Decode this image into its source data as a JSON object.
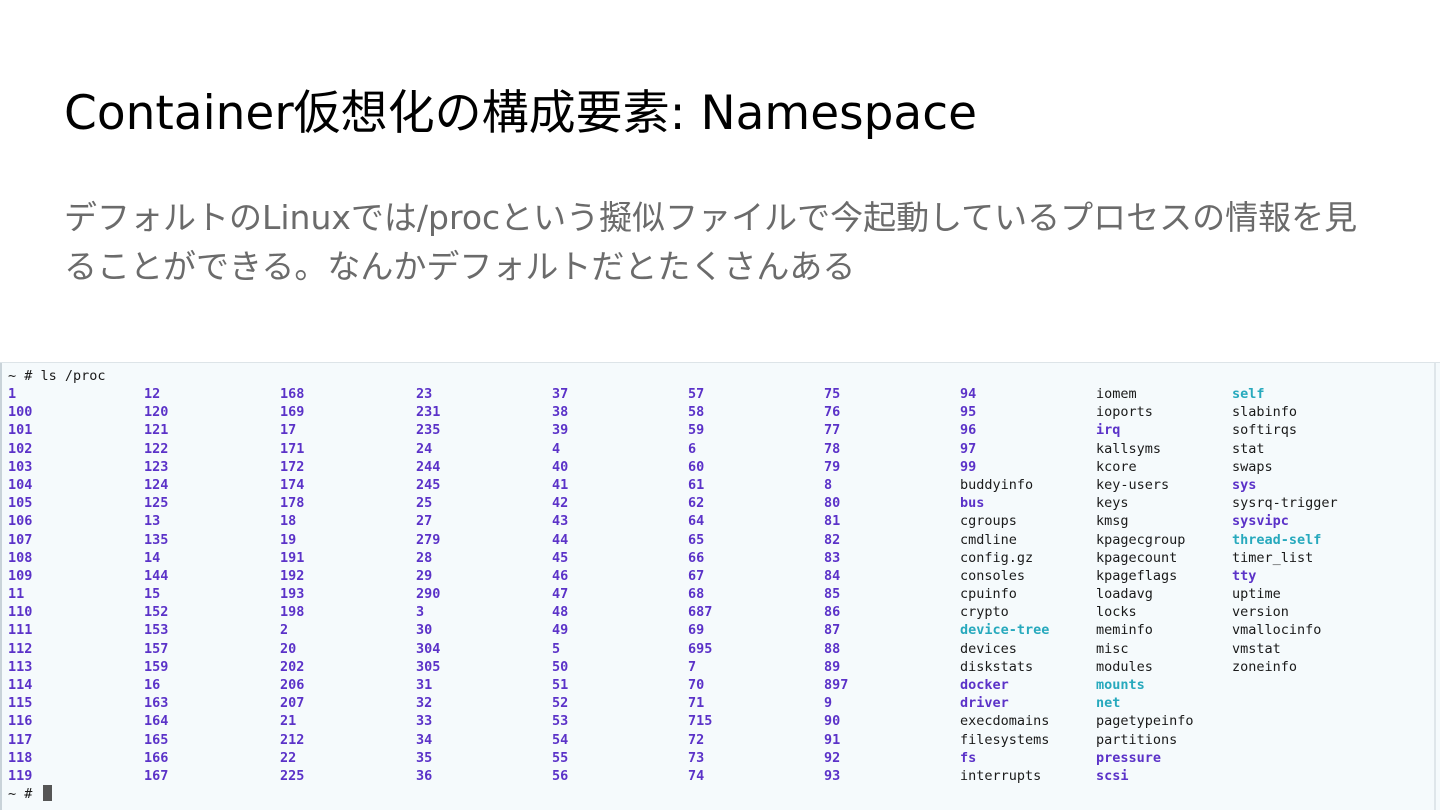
{
  "slide": {
    "title": "Container仮想化の構成要素: Namespace",
    "body": "デフォルトのLinuxでは/procという擬似ファイルで今起動しているプロセスの情報を見ることができる。なんかデフォルトだとたくさんある"
  },
  "terminal": {
    "command_prompt": "~ # ls /proc",
    "end_prompt": "~ # ",
    "colors": {
      "background": "#f5fafc",
      "directory": "#5b32c8",
      "symlink": "#27a9bd",
      "file": "#1a1a1a"
    },
    "columns": [
      [
        {
          "name": "1",
          "kind": "dir"
        },
        {
          "name": "100",
          "kind": "dir"
        },
        {
          "name": "101",
          "kind": "dir"
        },
        {
          "name": "102",
          "kind": "dir"
        },
        {
          "name": "103",
          "kind": "dir"
        },
        {
          "name": "104",
          "kind": "dir"
        },
        {
          "name": "105",
          "kind": "dir"
        },
        {
          "name": "106",
          "kind": "dir"
        },
        {
          "name": "107",
          "kind": "dir"
        },
        {
          "name": "108",
          "kind": "dir"
        },
        {
          "name": "109",
          "kind": "dir"
        },
        {
          "name": "11",
          "kind": "dir"
        },
        {
          "name": "110",
          "kind": "dir"
        },
        {
          "name": "111",
          "kind": "dir"
        },
        {
          "name": "112",
          "kind": "dir"
        },
        {
          "name": "113",
          "kind": "dir"
        },
        {
          "name": "114",
          "kind": "dir"
        },
        {
          "name": "115",
          "kind": "dir"
        },
        {
          "name": "116",
          "kind": "dir"
        },
        {
          "name": "117",
          "kind": "dir"
        },
        {
          "name": "118",
          "kind": "dir"
        },
        {
          "name": "119",
          "kind": "dir"
        }
      ],
      [
        {
          "name": "12",
          "kind": "dir"
        },
        {
          "name": "120",
          "kind": "dir"
        },
        {
          "name": "121",
          "kind": "dir"
        },
        {
          "name": "122",
          "kind": "dir"
        },
        {
          "name": "123",
          "kind": "dir"
        },
        {
          "name": "124",
          "kind": "dir"
        },
        {
          "name": "125",
          "kind": "dir"
        },
        {
          "name": "13",
          "kind": "dir"
        },
        {
          "name": "135",
          "kind": "dir"
        },
        {
          "name": "14",
          "kind": "dir"
        },
        {
          "name": "144",
          "kind": "dir"
        },
        {
          "name": "15",
          "kind": "dir"
        },
        {
          "name": "152",
          "kind": "dir"
        },
        {
          "name": "153",
          "kind": "dir"
        },
        {
          "name": "157",
          "kind": "dir"
        },
        {
          "name": "159",
          "kind": "dir"
        },
        {
          "name": "16",
          "kind": "dir"
        },
        {
          "name": "163",
          "kind": "dir"
        },
        {
          "name": "164",
          "kind": "dir"
        },
        {
          "name": "165",
          "kind": "dir"
        },
        {
          "name": "166",
          "kind": "dir"
        },
        {
          "name": "167",
          "kind": "dir"
        }
      ],
      [
        {
          "name": "168",
          "kind": "dir"
        },
        {
          "name": "169",
          "kind": "dir"
        },
        {
          "name": "17",
          "kind": "dir"
        },
        {
          "name": "171",
          "kind": "dir"
        },
        {
          "name": "172",
          "kind": "dir"
        },
        {
          "name": "174",
          "kind": "dir"
        },
        {
          "name": "178",
          "kind": "dir"
        },
        {
          "name": "18",
          "kind": "dir"
        },
        {
          "name": "19",
          "kind": "dir"
        },
        {
          "name": "191",
          "kind": "dir"
        },
        {
          "name": "192",
          "kind": "dir"
        },
        {
          "name": "193",
          "kind": "dir"
        },
        {
          "name": "198",
          "kind": "dir"
        },
        {
          "name": "2",
          "kind": "dir"
        },
        {
          "name": "20",
          "kind": "dir"
        },
        {
          "name": "202",
          "kind": "dir"
        },
        {
          "name": "206",
          "kind": "dir"
        },
        {
          "name": "207",
          "kind": "dir"
        },
        {
          "name": "21",
          "kind": "dir"
        },
        {
          "name": "212",
          "kind": "dir"
        },
        {
          "name": "22",
          "kind": "dir"
        },
        {
          "name": "225",
          "kind": "dir"
        }
      ],
      [
        {
          "name": "23",
          "kind": "dir"
        },
        {
          "name": "231",
          "kind": "dir"
        },
        {
          "name": "235",
          "kind": "dir"
        },
        {
          "name": "24",
          "kind": "dir"
        },
        {
          "name": "244",
          "kind": "dir"
        },
        {
          "name": "245",
          "kind": "dir"
        },
        {
          "name": "25",
          "kind": "dir"
        },
        {
          "name": "27",
          "kind": "dir"
        },
        {
          "name": "279",
          "kind": "dir"
        },
        {
          "name": "28",
          "kind": "dir"
        },
        {
          "name": "29",
          "kind": "dir"
        },
        {
          "name": "290",
          "kind": "dir"
        },
        {
          "name": "3",
          "kind": "dir"
        },
        {
          "name": "30",
          "kind": "dir"
        },
        {
          "name": "304",
          "kind": "dir"
        },
        {
          "name": "305",
          "kind": "dir"
        },
        {
          "name": "31",
          "kind": "dir"
        },
        {
          "name": "32",
          "kind": "dir"
        },
        {
          "name": "33",
          "kind": "dir"
        },
        {
          "name": "34",
          "kind": "dir"
        },
        {
          "name": "35",
          "kind": "dir"
        },
        {
          "name": "36",
          "kind": "dir"
        }
      ],
      [
        {
          "name": "37",
          "kind": "dir"
        },
        {
          "name": "38",
          "kind": "dir"
        },
        {
          "name": "39",
          "kind": "dir"
        },
        {
          "name": "4",
          "kind": "dir"
        },
        {
          "name": "40",
          "kind": "dir"
        },
        {
          "name": "41",
          "kind": "dir"
        },
        {
          "name": "42",
          "kind": "dir"
        },
        {
          "name": "43",
          "kind": "dir"
        },
        {
          "name": "44",
          "kind": "dir"
        },
        {
          "name": "45",
          "kind": "dir"
        },
        {
          "name": "46",
          "kind": "dir"
        },
        {
          "name": "47",
          "kind": "dir"
        },
        {
          "name": "48",
          "kind": "dir"
        },
        {
          "name": "49",
          "kind": "dir"
        },
        {
          "name": "5",
          "kind": "dir"
        },
        {
          "name": "50",
          "kind": "dir"
        },
        {
          "name": "51",
          "kind": "dir"
        },
        {
          "name": "52",
          "kind": "dir"
        },
        {
          "name": "53",
          "kind": "dir"
        },
        {
          "name": "54",
          "kind": "dir"
        },
        {
          "name": "55",
          "kind": "dir"
        },
        {
          "name": "56",
          "kind": "dir"
        }
      ],
      [
        {
          "name": "57",
          "kind": "dir"
        },
        {
          "name": "58",
          "kind": "dir"
        },
        {
          "name": "59",
          "kind": "dir"
        },
        {
          "name": "6",
          "kind": "dir"
        },
        {
          "name": "60",
          "kind": "dir"
        },
        {
          "name": "61",
          "kind": "dir"
        },
        {
          "name": "62",
          "kind": "dir"
        },
        {
          "name": "64",
          "kind": "dir"
        },
        {
          "name": "65",
          "kind": "dir"
        },
        {
          "name": "66",
          "kind": "dir"
        },
        {
          "name": "67",
          "kind": "dir"
        },
        {
          "name": "68",
          "kind": "dir"
        },
        {
          "name": "687",
          "kind": "dir"
        },
        {
          "name": "69",
          "kind": "dir"
        },
        {
          "name": "695",
          "kind": "dir"
        },
        {
          "name": "7",
          "kind": "dir"
        },
        {
          "name": "70",
          "kind": "dir"
        },
        {
          "name": "71",
          "kind": "dir"
        },
        {
          "name": "715",
          "kind": "dir"
        },
        {
          "name": "72",
          "kind": "dir"
        },
        {
          "name": "73",
          "kind": "dir"
        },
        {
          "name": "74",
          "kind": "dir"
        }
      ],
      [
        {
          "name": "75",
          "kind": "dir"
        },
        {
          "name": "76",
          "kind": "dir"
        },
        {
          "name": "77",
          "kind": "dir"
        },
        {
          "name": "78",
          "kind": "dir"
        },
        {
          "name": "79",
          "kind": "dir"
        },
        {
          "name": "8",
          "kind": "dir"
        },
        {
          "name": "80",
          "kind": "dir"
        },
        {
          "name": "81",
          "kind": "dir"
        },
        {
          "name": "82",
          "kind": "dir"
        },
        {
          "name": "83",
          "kind": "dir"
        },
        {
          "name": "84",
          "kind": "dir"
        },
        {
          "name": "85",
          "kind": "dir"
        },
        {
          "name": "86",
          "kind": "dir"
        },
        {
          "name": "87",
          "kind": "dir"
        },
        {
          "name": "88",
          "kind": "dir"
        },
        {
          "name": "89",
          "kind": "dir"
        },
        {
          "name": "897",
          "kind": "dir"
        },
        {
          "name": "9",
          "kind": "dir"
        },
        {
          "name": "90",
          "kind": "dir"
        },
        {
          "name": "91",
          "kind": "dir"
        },
        {
          "name": "92",
          "kind": "dir"
        },
        {
          "name": "93",
          "kind": "dir"
        }
      ],
      [
        {
          "name": "94",
          "kind": "dir"
        },
        {
          "name": "95",
          "kind": "dir"
        },
        {
          "name": "96",
          "kind": "dir"
        },
        {
          "name": "97",
          "kind": "dir"
        },
        {
          "name": "99",
          "kind": "dir"
        },
        {
          "name": "buddyinfo",
          "kind": "file"
        },
        {
          "name": "bus",
          "kind": "dir"
        },
        {
          "name": "cgroups",
          "kind": "file"
        },
        {
          "name": "cmdline",
          "kind": "file"
        },
        {
          "name": "config.gz",
          "kind": "file"
        },
        {
          "name": "consoles",
          "kind": "file"
        },
        {
          "name": "cpuinfo",
          "kind": "file"
        },
        {
          "name": "crypto",
          "kind": "file"
        },
        {
          "name": "device-tree",
          "kind": "link"
        },
        {
          "name": "devices",
          "kind": "file"
        },
        {
          "name": "diskstats",
          "kind": "file"
        },
        {
          "name": "docker",
          "kind": "dir"
        },
        {
          "name": "driver",
          "kind": "dir"
        },
        {
          "name": "execdomains",
          "kind": "file"
        },
        {
          "name": "filesystems",
          "kind": "file"
        },
        {
          "name": "fs",
          "kind": "dir"
        },
        {
          "name": "interrupts",
          "kind": "file"
        }
      ],
      [
        {
          "name": "iomem",
          "kind": "file"
        },
        {
          "name": "ioports",
          "kind": "file"
        },
        {
          "name": "irq",
          "kind": "dir"
        },
        {
          "name": "kallsyms",
          "kind": "file"
        },
        {
          "name": "kcore",
          "kind": "file"
        },
        {
          "name": "key-users",
          "kind": "file"
        },
        {
          "name": "keys",
          "kind": "file"
        },
        {
          "name": "kmsg",
          "kind": "file"
        },
        {
          "name": "kpagecgroup",
          "kind": "file"
        },
        {
          "name": "kpagecount",
          "kind": "file"
        },
        {
          "name": "kpageflags",
          "kind": "file"
        },
        {
          "name": "loadavg",
          "kind": "file"
        },
        {
          "name": "locks",
          "kind": "file"
        },
        {
          "name": "meminfo",
          "kind": "file"
        },
        {
          "name": "misc",
          "kind": "file"
        },
        {
          "name": "modules",
          "kind": "file"
        },
        {
          "name": "mounts",
          "kind": "link"
        },
        {
          "name": "net",
          "kind": "link"
        },
        {
          "name": "pagetypeinfo",
          "kind": "file"
        },
        {
          "name": "partitions",
          "kind": "file"
        },
        {
          "name": "pressure",
          "kind": "dir"
        },
        {
          "name": "scsi",
          "kind": "dir"
        }
      ],
      [
        {
          "name": "self",
          "kind": "link"
        },
        {
          "name": "slabinfo",
          "kind": "file"
        },
        {
          "name": "softirqs",
          "kind": "file"
        },
        {
          "name": "stat",
          "kind": "file"
        },
        {
          "name": "swaps",
          "kind": "file"
        },
        {
          "name": "sys",
          "kind": "dir"
        },
        {
          "name": "sysrq-trigger",
          "kind": "file"
        },
        {
          "name": "sysvipc",
          "kind": "dir"
        },
        {
          "name": "thread-self",
          "kind": "link"
        },
        {
          "name": "timer_list",
          "kind": "file"
        },
        {
          "name": "tty",
          "kind": "dir"
        },
        {
          "name": "uptime",
          "kind": "file"
        },
        {
          "name": "version",
          "kind": "file"
        },
        {
          "name": "vmallocinfo",
          "kind": "file"
        },
        {
          "name": "vmstat",
          "kind": "file"
        },
        {
          "name": "zoneinfo",
          "kind": "file"
        }
      ]
    ]
  }
}
